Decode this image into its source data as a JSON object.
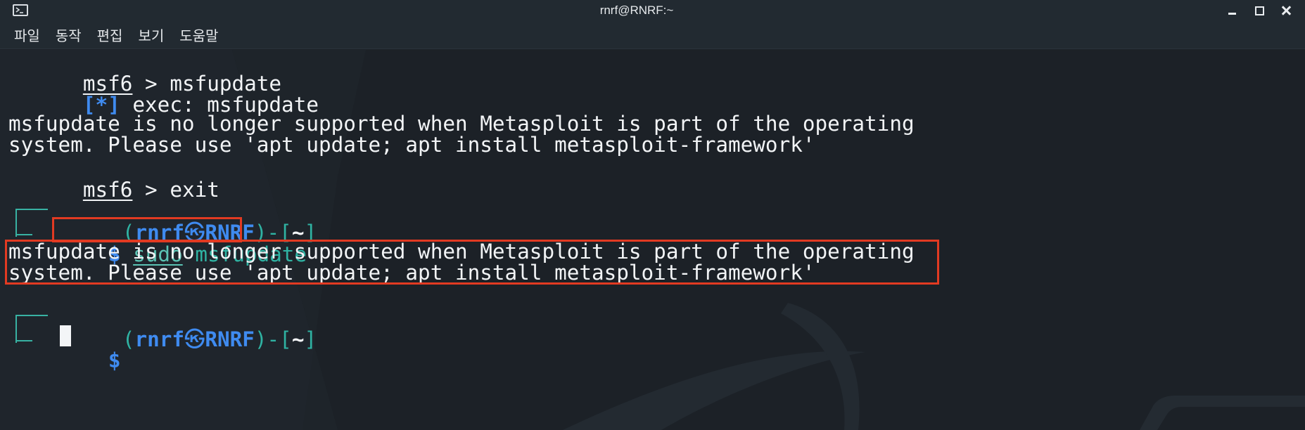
{
  "window": {
    "title": "rnrf@RNRF:~",
    "icon": "terminal-icon"
  },
  "menu": [
    "파일",
    "동작",
    "편집",
    "보기",
    "도움말"
  ],
  "terminal": {
    "line1": {
      "prompt": "msf6",
      "sep": " > ",
      "cmd": "msfupdate"
    },
    "line2": {
      "marker": "[*]",
      "text": " exec: msfupdate"
    },
    "line3": "msfupdate is no longer supported when Metasploit is part of the operating",
    "line4": "system. Please use 'apt update; apt install metasploit-framework'",
    "line5": {
      "prompt": "msf6",
      "sep": " > ",
      "cmd": "exit"
    },
    "prompt1": {
      "open": "(",
      "user": "rnrf",
      "at": "㉿",
      "host": "RNRF",
      "close": ")-[",
      "dir": "~",
      "end": "]"
    },
    "prompt1_cmd": {
      "dollar": "$",
      "sudo": "sudo",
      "rest": " msfupdate"
    },
    "line6": "msfupdate is no longer supported when Metasploit is part of the operating",
    "line7": "system. Please use 'apt update; apt install metasploit-framework'",
    "prompt2": {
      "open": "(",
      "user": "rnrf",
      "at": "㉿",
      "host": "RNRF",
      "close": ")-[",
      "dir": "~",
      "end": "]"
    },
    "prompt2_cmd": {
      "dollar": "$"
    }
  },
  "colors": {
    "accent_blue": "#3f8bf0",
    "prompt_teal": "#2fb3a3",
    "highlight_red": "#e23a22",
    "background": "#1c2127"
  }
}
